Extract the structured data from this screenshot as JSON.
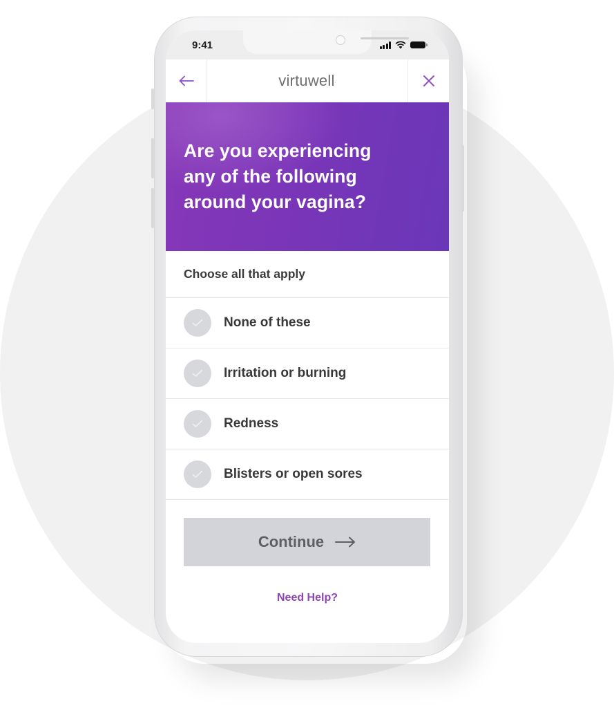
{
  "status_bar": {
    "time": "9:41",
    "icons": [
      "cellular-signal-icon",
      "wifi-icon",
      "battery-icon"
    ]
  },
  "nav": {
    "back_icon": "arrow-left-icon",
    "logo": "virtuwell",
    "logo_mark": "·",
    "close_icon": "close-x-icon"
  },
  "hero": {
    "title_lines": [
      "Are you experiencing",
      "any of the following",
      "around your vagina?"
    ]
  },
  "prompt": "Choose all that apply",
  "options": [
    {
      "label": "None of these",
      "checked": false
    },
    {
      "label": "Irritation or burning",
      "checked": false
    },
    {
      "label": "Redness",
      "checked": false
    },
    {
      "label": "Blisters or open sores",
      "checked": false
    }
  ],
  "continue_button": {
    "label": "Continue",
    "icon": "arrow-right-icon",
    "disabled": true
  },
  "help_link": "Need Help?",
  "colors": {
    "accent": "#8e4fc2",
    "hero_start": "#8738b8",
    "hero_end": "#6a37b8",
    "button_disabled": "#d2d4d9",
    "check_unselected": "#d6d8dc",
    "help_link": "#8e44b4"
  }
}
